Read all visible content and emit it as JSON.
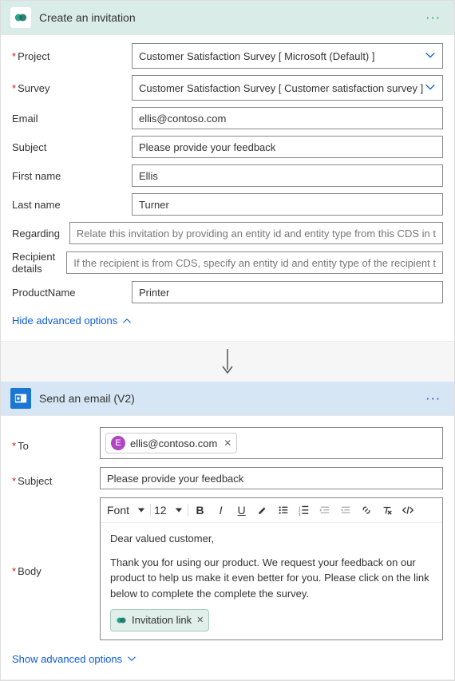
{
  "invitation": {
    "title": "Create an invitation",
    "fields": {
      "project_label": "Project",
      "project_value": "Customer Satisfaction Survey [ Microsoft (Default) ]",
      "survey_label": "Survey",
      "survey_value": "Customer Satisfaction Survey [ Customer satisfaction survey ]",
      "email_label": "Email",
      "email_value": "ellis@contoso.com",
      "subject_label": "Subject",
      "subject_value": "Please provide your feedback",
      "firstname_label": "First name",
      "firstname_value": "Ellis",
      "lastname_label": "Last name",
      "lastname_value": "Turner",
      "regarding_label": "Regarding",
      "regarding_placeholder": "Relate this invitation by providing an entity id and entity type from this CDS in t",
      "recipient_label": "Recipient details",
      "recipient_placeholder": "If the recipient is from CDS, specify an entity id and entity type of the recipient t",
      "productname_label": "ProductName",
      "productname_value": "Printer"
    },
    "hide_advanced": "Hide advanced options"
  },
  "email": {
    "title": "Send an email (V2)",
    "to_label": "To",
    "to_chip_initial": "E",
    "to_chip_value": "ellis@contoso.com",
    "subject_label": "Subject",
    "subject_value": "Please provide your feedback",
    "body_label": "Body",
    "toolbar": {
      "font": "Font",
      "size": "12"
    },
    "body_greeting": "Dear valued customer,",
    "body_text": "Thank you for using our product. We request your feedback on our product to help us make it even better for you. Please click on the link below to complete the complete the survey.",
    "token": "Invitation link",
    "show_advanced": "Show advanced options"
  }
}
